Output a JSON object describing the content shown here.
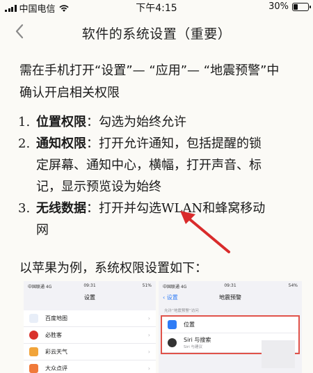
{
  "status_bar": {
    "carrier": "中国电信",
    "time": "下午4:15",
    "battery": "30%",
    "battery_level": 0.3
  },
  "nav": {
    "title": "软件的系统设置（重要）"
  },
  "intro_paragraph": {
    "line1": "需在手机打开“设置”— “应用”— “地震预警”中",
    "line2": "确认开启相关权限"
  },
  "permissions": [
    {
      "num": "1.",
      "label": "位置权限",
      "lines": [
        "：勾选为始终允许"
      ]
    },
    {
      "num": "2.",
      "label": "通知权限",
      "lines": [
        "：打开允许通知，包括提醒的锁",
        "定屏幕、通知中心，横幅，打开声音、标",
        "记，显示预览设为始终"
      ]
    },
    {
      "num": "3.",
      "label": "无线数据",
      "text_before": "：打开并勾选",
      "wlan": "WLAN",
      "text_after": "和蜂窝移动",
      "line2": "网"
    }
  ],
  "example_text": "以苹果为例，系统权限设置如下：",
  "screenshot_left": {
    "carrier": "中国联通  4G",
    "time": "09:31",
    "battery": "51%",
    "title": "设置",
    "items": [
      "百度地图",
      "必胜客",
      "彩云天气",
      "大众点评"
    ]
  },
  "screenshot_right": {
    "carrier": "中国联通  4G",
    "time": "09:31",
    "battery": "54%",
    "back": "设置",
    "title": "地震预警",
    "caption": "允许“地震预警”访问",
    "items": [
      {
        "label": "位置",
        "sub": ""
      },
      {
        "label": "Siri 与搜索",
        "sub": "Siri 与建议"
      }
    ]
  },
  "colors": {
    "background": "#fbfaf6",
    "arrow": "#d92b2b",
    "highlight_box": "#e0524a",
    "ios_blue": "#2f7cf6"
  }
}
